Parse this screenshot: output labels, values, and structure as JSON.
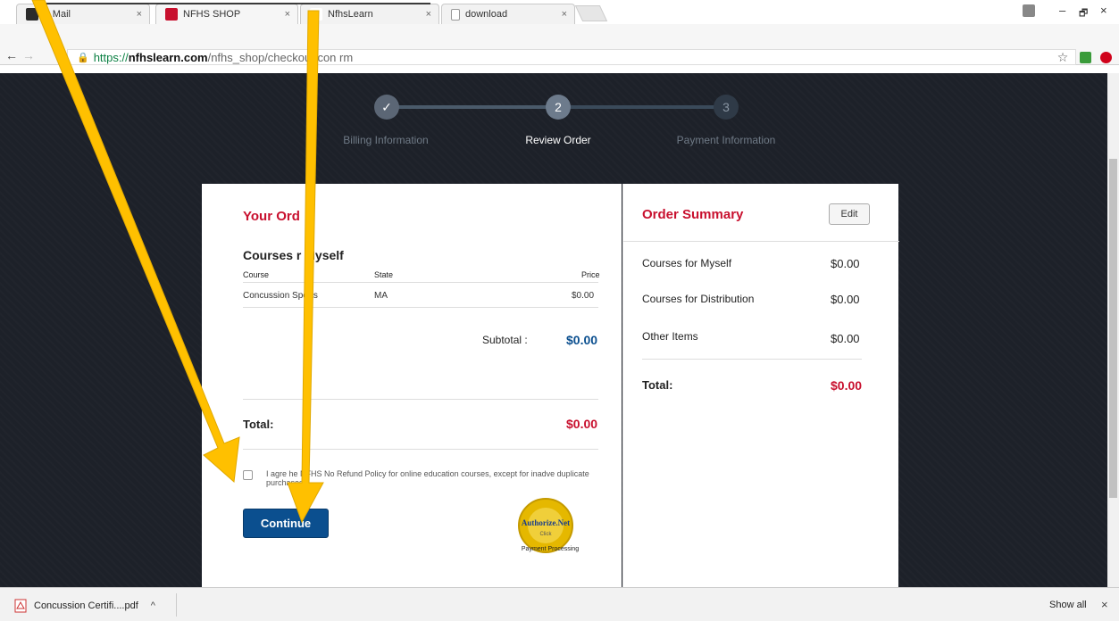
{
  "tabs": [
    {
      "title": "A   Mail",
      "favicon_color": "#2b2b2b"
    },
    {
      "title": "NFHS SHOP",
      "favicon_color": "#c8102e"
    },
    {
      "title": "NfhsLearn",
      "favicon_color": "#ffffff"
    },
    {
      "title": "download",
      "favicon_color": "#ffffff"
    }
  ],
  "tab_close_glyph": "×",
  "window_controls": {
    "minimize": "–",
    "restore": "🗗",
    "close": "×"
  },
  "address_bar": {
    "secure_prefix": "https://",
    "host": "nfhslearn.com",
    "path": "/nfhs_shop/checkout/con     rm"
  },
  "toolbar_icons": [
    "star-icon",
    "extension-icon",
    "opera-icon"
  ],
  "steps": [
    {
      "number": "✓",
      "label": "Billing Information",
      "state": "complete"
    },
    {
      "number": "2",
      "label": "Review Order",
      "state": "active"
    },
    {
      "number": "3",
      "label": "Payment Information",
      "state": "pending"
    }
  ],
  "order": {
    "heading": "Your Ord",
    "section_title": "Courses    r Myself",
    "columns": [
      "Course",
      "State",
      "Price"
    ],
    "rows": [
      {
        "course": "Concussion     Sports",
        "state": "MA",
        "price": "$0.00"
      }
    ],
    "subtotal_label": "Subtotal :",
    "subtotal_value": "$0.00",
    "total_label": "Total:",
    "total_value": "$0.00",
    "agree_text": "I agre      he NFHS No Refund Policy for online education courses, except for inadve      duplicate purchases.",
    "continue_label": "Continue",
    "badge_text": "Authorize.Net",
    "badge_sub": "Click",
    "badge_caption": "Payment Processing"
  },
  "summary": {
    "heading": "Order Summary",
    "edit_label": "Edit",
    "rows": [
      {
        "label": "Courses for Myself",
        "value": "$0.00"
      },
      {
        "label": "Courses for Distribution",
        "value": "$0.00"
      },
      {
        "label": "Other Items",
        "value": "$0.00"
      }
    ],
    "total_label": "Total:",
    "total_value": "$0.00"
  },
  "download_bar": {
    "file_label": "Concussion Certifi....pdf",
    "caret": "^",
    "show_all": "Show all",
    "close": "×"
  },
  "colors": {
    "accent_red": "#c8102e",
    "accent_blue": "#0b4f8f",
    "arrow": "#ffc000",
    "page_bg": "#1d2129"
  }
}
